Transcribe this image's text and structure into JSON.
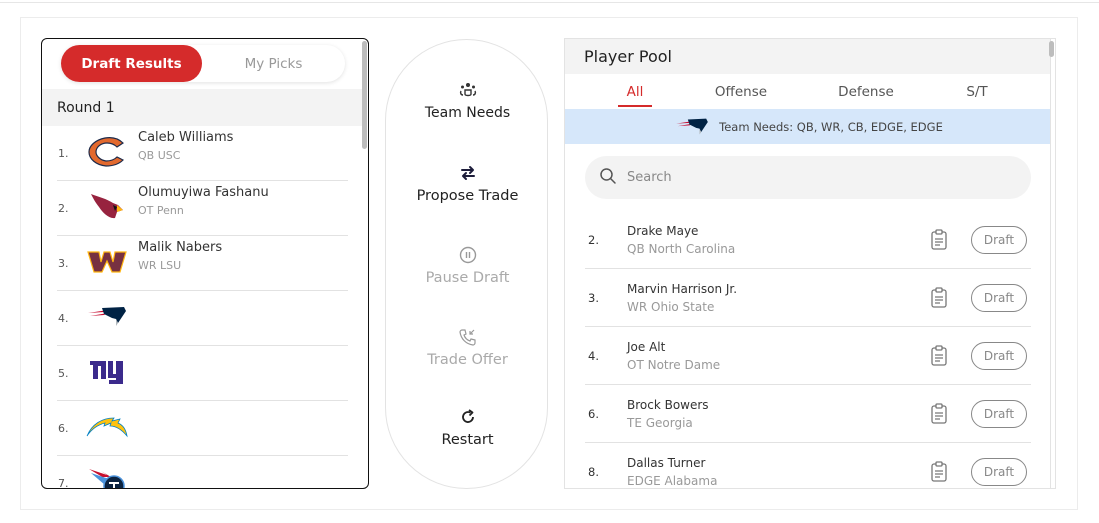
{
  "left_panel": {
    "segment": {
      "active_label": "Draft Results",
      "inactive_label": "My Picks"
    },
    "round_label": "Round 1",
    "picks": [
      {
        "num": "1.",
        "team_icon": "bears-logo-icon",
        "name": "Caleb Williams",
        "sub": "QB USC"
      },
      {
        "num": "2.",
        "team_icon": "cardinals-logo-icon",
        "name": "Olumuyiwa Fashanu",
        "sub": "OT Penn"
      },
      {
        "num": "3.",
        "team_icon": "commanders-logo-icon",
        "name": "Malik Nabers",
        "sub": "WR LSU"
      },
      {
        "num": "4.",
        "team_icon": "patriots-logo-icon",
        "name": "",
        "sub": ""
      },
      {
        "num": "5.",
        "team_icon": "giants-logo-icon",
        "name": "",
        "sub": ""
      },
      {
        "num": "6.",
        "team_icon": "chargers-logo-icon",
        "name": "",
        "sub": ""
      },
      {
        "num": "7.",
        "team_icon": "titans-logo-icon",
        "name": "",
        "sub": ""
      }
    ]
  },
  "actions": {
    "team_needs": {
      "label": "Team Needs",
      "icon": "team-icon"
    },
    "propose_trade": {
      "label": "Propose Trade",
      "icon": "swap-arrows-icon"
    },
    "pause_draft": {
      "label": "Pause Draft",
      "icon": "pause-icon",
      "disabled": true
    },
    "trade_offer": {
      "label": "Trade Offer",
      "icon": "phone-incoming-icon",
      "disabled": true
    },
    "restart": {
      "label": "Restart",
      "icon": "restart-icon"
    }
  },
  "player_pool": {
    "title": "Player Pool",
    "tabs": [
      {
        "label": "All",
        "active": true
      },
      {
        "label": "Offense",
        "active": false
      },
      {
        "label": "Defense",
        "active": false
      },
      {
        "label": "S/T",
        "active": false
      }
    ],
    "team_needs_text": "Team Needs: QB, WR, CB, EDGE, EDGE",
    "search_placeholder": "Search",
    "search_value": "",
    "draft_button_label": "Draft",
    "players": [
      {
        "rank": "2.",
        "name": "Drake Maye",
        "sub": "QB North Carolina"
      },
      {
        "rank": "3.",
        "name": "Marvin Harrison Jr.",
        "sub": "WR Ohio State"
      },
      {
        "rank": "4.",
        "name": "Joe Alt",
        "sub": "OT Notre Dame"
      },
      {
        "rank": "6.",
        "name": "Brock Bowers",
        "sub": "TE Georgia"
      },
      {
        "rank": "8.",
        "name": "Dallas Turner",
        "sub": "EDGE Alabama"
      }
    ]
  },
  "colors": {
    "accent": "#d52b2b",
    "needs_bar_bg": "#d6e7fa",
    "header_bg": "#f3f3f3",
    "muted_text": "#999999"
  }
}
